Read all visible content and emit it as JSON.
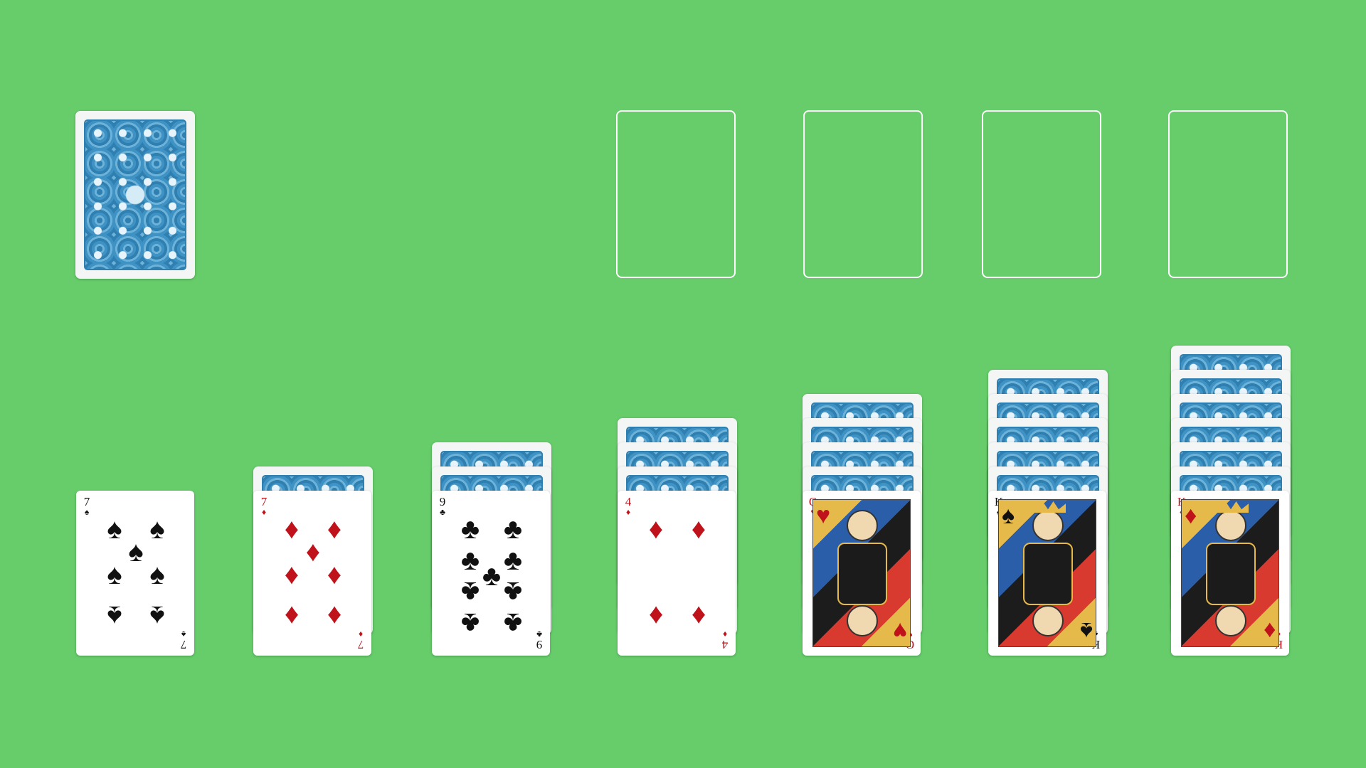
{
  "colors": {
    "table": "#66cd6a",
    "slot_border": "#ffffff",
    "red_suit": "#c0121a",
    "black_suit": "#111111"
  },
  "stock": {
    "facedown": true
  },
  "foundations": [
    {
      "empty": true
    },
    {
      "empty": true
    },
    {
      "empty": true
    },
    {
      "empty": true
    }
  ],
  "tableau": [
    {
      "hidden_count": 0,
      "top": {
        "rank": "7",
        "suit": "♠",
        "color": "black"
      }
    },
    {
      "hidden_count": 1,
      "top": {
        "rank": "7",
        "suit": "♦",
        "color": "red"
      }
    },
    {
      "hidden_count": 2,
      "top": {
        "rank": "9",
        "suit": "♣",
        "color": "black"
      }
    },
    {
      "hidden_count": 3,
      "top": {
        "rank": "4",
        "suit": "♦",
        "color": "red"
      }
    },
    {
      "hidden_count": 4,
      "top": {
        "rank": "Q",
        "suit": "♥",
        "color": "red"
      }
    },
    {
      "hidden_count": 5,
      "top": {
        "rank": "K",
        "suit": "♠",
        "color": "black"
      }
    },
    {
      "hidden_count": 6,
      "top": {
        "rank": "K",
        "suit": "♦",
        "color": "red"
      }
    }
  ]
}
